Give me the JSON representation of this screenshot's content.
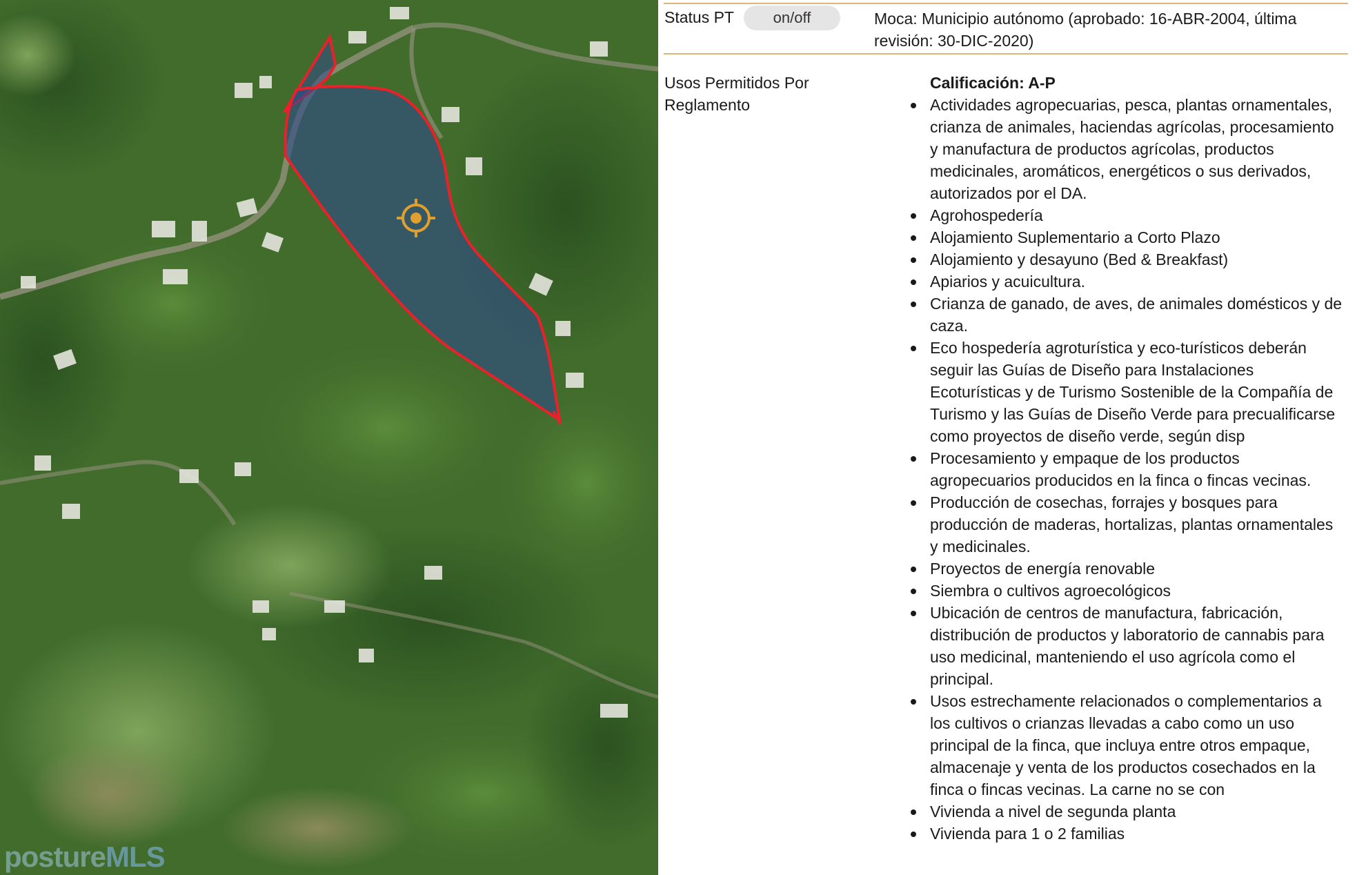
{
  "map": {
    "parcel_outline_color": "#e8222a",
    "parcel_fill_color": "#2f4a8a",
    "marker_icon": "crosshair-target-icon",
    "marker_color": "#e0a030",
    "watermark_brand": "posture",
    "watermark_mls": "MLS"
  },
  "info": {
    "status_label": "Status PT",
    "toggle_label": "on/off",
    "municipio_text": "Moca: Municipio autónomo (aprobado: 16-ABR-2004, última revisión: 30-DIC-2020)",
    "usos_label": "Usos Permitidos Por Reglamento",
    "calificacion": "Calificación: A-P",
    "usos": [
      "Actividades agropecuarias, pesca, plantas ornamentales, crianza de animales, haciendas agrícolas, procesamiento y manufactura de productos agrícolas, productos medicinales, aromáticos, energéticos o sus derivados, autorizados por el DA.",
      "Agrohospedería",
      "Alojamiento Suplementario a Corto Plazo",
      "Alojamiento y desayuno (Bed & Breakfast)",
      "Apiarios y acuicultura.",
      "Crianza de ganado, de aves, de animales domésticos y de caza.",
      "Eco hospedería agroturística y eco-turísticos deberán seguir las Guías de Diseño para Instalaciones Ecoturísticas y de Turismo Sostenible de la Compañía de Turismo y las Guías de Diseño Verde para precualificarse como proyectos de diseño verde, según disp",
      "Procesamiento y empaque de los productos agropecuarios producidos en la finca o fincas vecinas.",
      "Producción de cosechas, forrajes y bosques para producción de maderas, hortalizas, plantas ornamentales y medicinales.",
      "Proyectos de energía renovable",
      "Siembra o cultivos agroecológicos",
      "Ubicación de centros de manufactura, fabricación, distribución de productos y laboratorio de cannabis para uso medicinal, manteniendo el uso agrícola como el principal.",
      "Usos estrechamente relacionados o complementarios a los cultivos o crianzas llevadas a cabo como un uso principal de la finca, que incluya entre otros empaque, almacenaje y venta de los productos cosechados en la finca o fincas vecinas. La carne no se con",
      "Vivienda a nivel de segunda planta",
      "Vivienda para 1 o 2 familias"
    ]
  }
}
